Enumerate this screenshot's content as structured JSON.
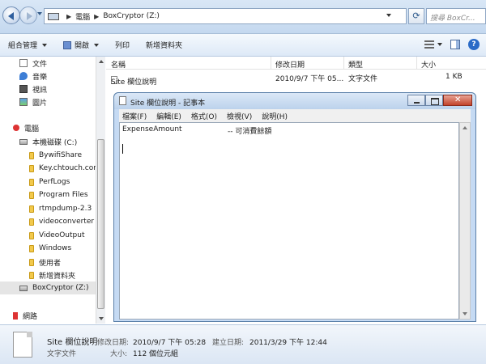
{
  "address": {
    "crumbs": [
      "電腦",
      "BoxCryptor (Z:)"
    ],
    "search_placeholder": "搜尋 BoxCr..."
  },
  "toolbar": {
    "organize": "組合管理",
    "open": "開啟",
    "print": "列印",
    "new_folder": "新增資料夾"
  },
  "nav": {
    "items": [
      "文件",
      "音樂",
      "視訊",
      "圖片"
    ],
    "computer": "電腦",
    "local_disk": "本機磁碟 (C:)",
    "folders": [
      "BywifiShare",
      "Key.chtouch.com",
      "PerfLogs",
      "Program Files",
      "rtmpdump-2.3",
      "videoconverter",
      "VideoOutput",
      "Windows",
      "使用者",
      "新增資料夾"
    ],
    "boxcryptor": "BoxCryptor (Z:)",
    "network": "網路"
  },
  "filelist": {
    "headers": [
      "名稱",
      "修改日期",
      "類型",
      "大小"
    ],
    "row": {
      "name": "Site 欄位說明",
      "date": "2010/9/7 下午 05...",
      "type": "文字文件",
      "size": "1 KB"
    }
  },
  "notepad": {
    "title": "Site 欄位說明 - 記事本",
    "menu": [
      "檔案(F)",
      "編輯(E)",
      "格式(O)",
      "檢視(V)",
      "說明(H)"
    ],
    "content_key": "ExpenseAmount",
    "content_value": "-- 可消費餘額"
  },
  "details": {
    "name": "Site 欄位說明",
    "type": "文字文件",
    "mod_label": "修改日期:",
    "mod_value": "2010/9/7 下午 05:28",
    "created_label": "建立日期:",
    "created_value": "2011/3/29 下午 12:44",
    "size_label": "大小:",
    "size_value": "112 個位元組"
  }
}
